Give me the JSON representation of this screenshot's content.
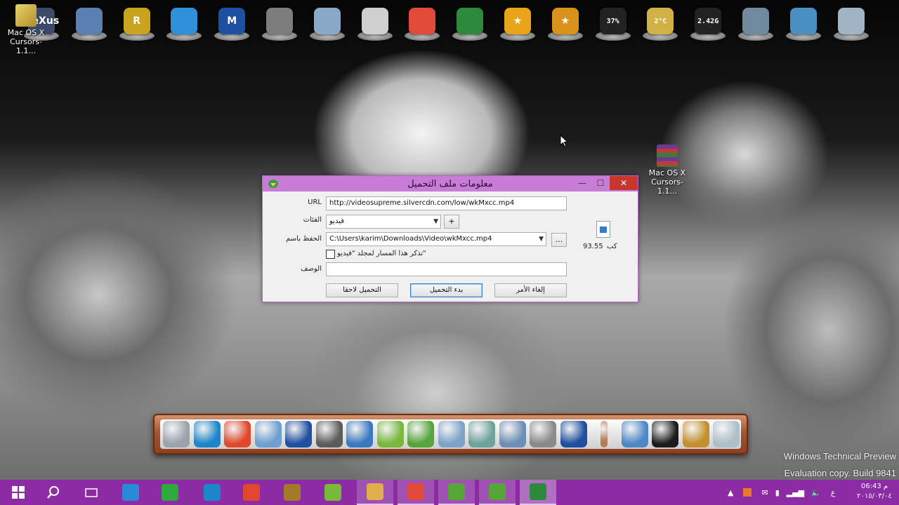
{
  "desktop": {
    "shortcut_topleft_label": "Mac OS X Cursors-1.1...",
    "shortcut_middle_label": "Mac OS X Cursors-1.1...",
    "watermark_line1": "Windows Technical Preview",
    "watermark_line2": "Evaluation copy. Build 9841"
  },
  "top_dock": {
    "icons": [
      {
        "name": "nexus-folder-icon",
        "text": "NeXus",
        "color": "#3b4a6b"
      },
      {
        "name": "computer-icon",
        "text": "",
        "color": "#5a7fb0"
      },
      {
        "name": "r-app-icon",
        "text": "R",
        "color": "#c9a31d"
      },
      {
        "name": "windows-logo-icon",
        "text": "",
        "color": "#2f8fd8"
      },
      {
        "name": "malwarebytes-icon",
        "text": "M",
        "color": "#1f4fa0"
      },
      {
        "name": "search-tool-icon",
        "text": "",
        "color": "#7d7d7d"
      },
      {
        "name": "dvd-icon",
        "text": "",
        "color": "#8aa9c9"
      },
      {
        "name": "clock-icon",
        "text": "",
        "color": "#cfcfcf"
      },
      {
        "name": "chrome-icon",
        "text": "",
        "color": "#e24b3a"
      },
      {
        "name": "idm-icon",
        "text": "",
        "color": "#2c8a3d"
      },
      {
        "name": "star-icon",
        "text": "★",
        "color": "#e8a51a"
      },
      {
        "name": "star-2-icon",
        "text": "★",
        "color": "#d9931b"
      },
      {
        "name": "cpu-meter-icon",
        "text": "37%",
        "color": "#222"
      },
      {
        "name": "weather-icon",
        "text": "2°C",
        "color": "#d1b146"
      },
      {
        "name": "memory-meter-icon",
        "text": "2.42G",
        "color": "#222"
      },
      {
        "name": "globe-icon",
        "text": "",
        "color": "#6f8a9e"
      },
      {
        "name": "photo-camera-icon",
        "text": "",
        "color": "#4a8fc2"
      },
      {
        "name": "recycle-bin-icon",
        "text": "",
        "color": "#9fb4c4"
      }
    ]
  },
  "dialog": {
    "title": "معلومات ملف التحميل",
    "url_label": "URL",
    "url_value": "http://videosupreme.silvercdn.com/low/wkMxcc.mp4",
    "category_label": "الفئات",
    "category_value": "فيديو",
    "add_category": "+",
    "saveas_label": "الحفظ باسم",
    "saveas_value": "C:\\Users\\karim\\Downloads\\Video\\wkMxcc.mp4",
    "browse": "...",
    "remember_label": "تذكر هذا المسار لمجلد \"فيديو\"",
    "description_label": "الوصف",
    "description_value": "",
    "size_value": "93.55",
    "size_unit": "كب",
    "buttons": {
      "later": "التحميل لاحقا",
      "start": "بدء التحميل",
      "cancel": "إلغاء الأمر"
    }
  },
  "bottom_dock": {
    "icons": [
      {
        "name": "monitor-icon",
        "color": "#9aa3ab"
      },
      {
        "name": "ccleaner-icon",
        "color": "#1b86c9"
      },
      {
        "name": "color-wheel-icon",
        "color": "#e0472d"
      },
      {
        "name": "dvd-maker-icon",
        "color": "#6d9fd0"
      },
      {
        "name": "malwarebytes-icon",
        "color": "#1f4fa0"
      },
      {
        "name": "magnifier-icon",
        "color": "#5c5c5c"
      },
      {
        "name": "network-globe-icon",
        "color": "#3a79c0"
      },
      {
        "name": "utorrent-icon",
        "color": "#78b93c"
      },
      {
        "name": "camtasia-icon",
        "color": "#55a53a"
      },
      {
        "name": "folder-docs-icon",
        "color": "#7ca3c8"
      },
      {
        "name": "folder-green-icon",
        "color": "#6ea29b"
      },
      {
        "name": "folder-pictures-icon",
        "color": "#6d8fb7"
      },
      {
        "name": "tools-icon",
        "color": "#8a8a8a"
      },
      {
        "name": "malwarebytes-2-icon",
        "color": "#1f4fa0"
      },
      {
        "name": "separator-icon",
        "color": "#b77c59"
      },
      {
        "name": "internet-globe-icon",
        "color": "#4d87c7"
      },
      {
        "name": "tshirt-icon",
        "color": "#1c1c1c"
      },
      {
        "name": "hammer-icon",
        "color": "#c48f2c"
      },
      {
        "name": "trash-icon",
        "color": "#aebfca"
      }
    ]
  },
  "taskbar": {
    "items": [
      {
        "name": "start-button",
        "color": "#ffffff"
      },
      {
        "name": "search-button",
        "color": "#ffffff"
      },
      {
        "name": "task-view-button",
        "color": "#ffffff"
      },
      {
        "name": "ie-button",
        "color": "#2a8ad8"
      },
      {
        "name": "store-button",
        "color": "#2eaa3a"
      },
      {
        "name": "ccleaner-taskbar-button",
        "color": "#1b86c9"
      },
      {
        "name": "color-taskbar-button",
        "color": "#e0472d"
      },
      {
        "name": "zoo-taskbar-button",
        "color": "#a37b28"
      },
      {
        "name": "utorrent-taskbar-button",
        "color": "#78b93c"
      },
      {
        "name": "explorer-taskbar-button",
        "color": "#e0b14b"
      },
      {
        "name": "chrome-taskbar-button",
        "color": "#e24b3a"
      },
      {
        "name": "camtasia-taskbar-button",
        "color": "#55a53a"
      },
      {
        "name": "camtasia-2-taskbar-button",
        "color": "#55a53a"
      },
      {
        "name": "idm-taskbar-button",
        "color": "#2c8a3d"
      }
    ],
    "tray_lang": "ع",
    "clock_time": "06:43 م",
    "clock_date": "٢٠١٥/٠٣/٠٤"
  }
}
